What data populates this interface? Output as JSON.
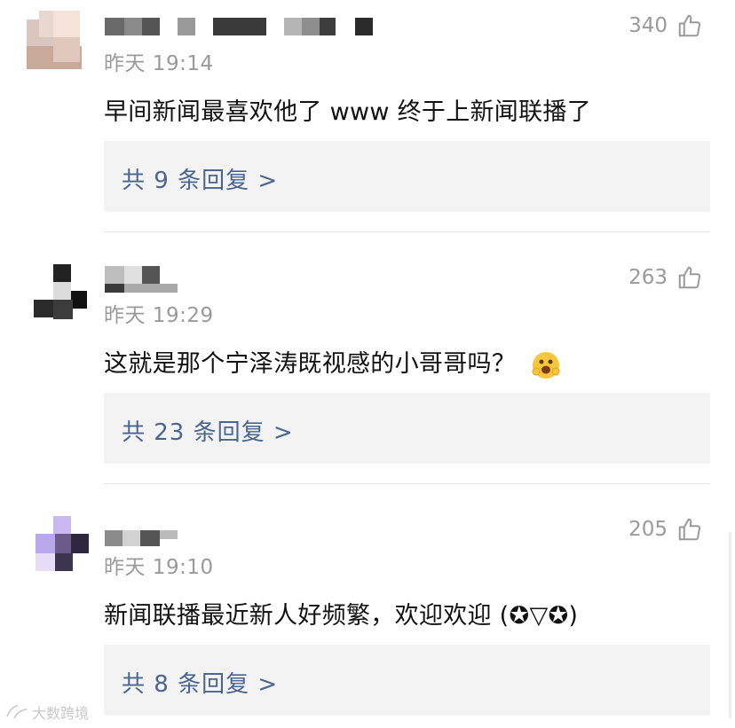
{
  "comments": [
    {
      "time": "昨天 19:14",
      "likes": "340",
      "text": "早间新闻最喜欢他了 www 终于上新闻联播了",
      "replies": "共 9 条回复 >"
    },
    {
      "time": "昨天 19:29",
      "likes": "263",
      "text": "这就是那个宁泽涛既视感的小哥哥吗？",
      "replies": "共 23 条回复 >"
    },
    {
      "time": "昨天 19:10",
      "likes": "205",
      "text": "新闻联播最近新人好频繁，欢迎欢迎 (✪▽✪)",
      "replies": "共 8 条回复 >"
    }
  ],
  "icons": {
    "like": "thumbs-up-icon",
    "emoji": "grinning-face-emoji"
  },
  "watermark": "大数跨境",
  "colors": {
    "reply_link": "#4a6590",
    "muted": "#9a9a9a",
    "reply_bg": "#f3f3f3"
  }
}
